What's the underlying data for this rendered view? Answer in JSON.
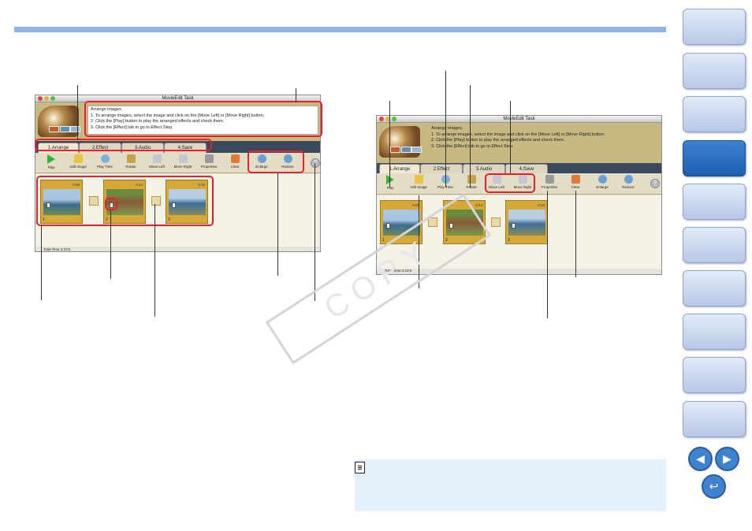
{
  "window": {
    "title": "MovieEdit Task"
  },
  "instructions": [
    "Arrange images.",
    "1. To arrange images, select the image and click on the [Move Left] or [Move Right] button.",
    "2. Click the [Play] button to play the arranged effects and check them.",
    "3. Click the [Effect] tab to go to Effect Step."
  ],
  "tabs": [
    "1.Arrange",
    "2.Effect",
    "3.Audio",
    "4.Save"
  ],
  "toolbar": {
    "play": "Play",
    "add_image": "Add Image",
    "play_time": "Play Time",
    "rotate": "Rotate",
    "move_left": "Move Left",
    "move_right": "Move Right",
    "properties": "Properties",
    "clear": "Clear",
    "enlarge": "Enlarge",
    "reduce": "Reduce",
    "help": "?"
  },
  "clips": [
    {
      "time": "0:06",
      "number": "1"
    },
    {
      "time": "0:14",
      "number": "2"
    },
    {
      "time": "0:10",
      "number": "3"
    }
  ],
  "total_time": "Total Time  2:10:0",
  "watermark": "COPY",
  "colors": {
    "accent": "#e8202a",
    "header_bar": "#8fb3e8",
    "nav_active": "#2a6bbd"
  }
}
